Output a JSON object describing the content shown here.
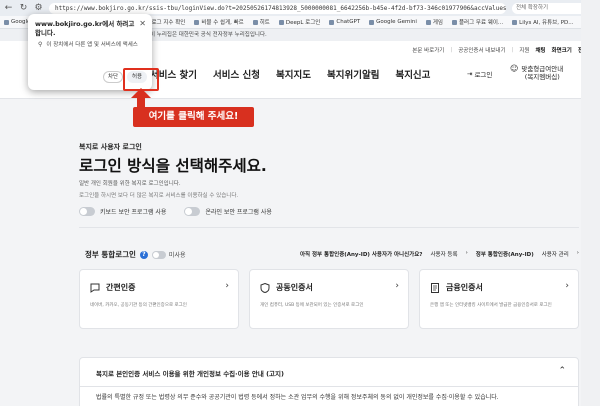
{
  "browser": {
    "url": "https://www.bokjiro.go.kr/ssis-tbu/loginView.do?t=20250526174813928_5000000081_6642256b-b45e-4f2d-bf73-346c01977906&accValues=c2#/",
    "extension_text": "전체 확장하기",
    "bookmarks": [
      "Google",
      "블로그 지수 확인",
      "비블 수 쉽게, 빠르",
      "히트",
      "DeepL 로그인",
      "ChatGPT",
      "Google Gemini",
      "게임",
      "플러그 무료 웨이...",
      "Lilys AI, 유튜브, PD..."
    ]
  },
  "gov_banner": "이 누리집은 대한민국 공식 전자정부 누리집입니다.",
  "header": {
    "util_links": [
      "본문 바로가기",
      "공공인증서 내보내기",
      "지원",
      "채팅",
      "화면크기",
      "전체"
    ],
    "nav": [
      "서비스 찾기",
      "서비스 신청",
      "복지지도",
      "복지위기알림",
      "복지신고"
    ],
    "login": "로그인",
    "help": [
      "맞춤형급여안내",
      "(복지멤버십)"
    ]
  },
  "popup": {
    "title": "www.bokjiro.go.kr에서 다음 작업을 하려고 합니다.",
    "title_display": "www.bokjiro.go.kr에서 하려고 합니다.",
    "message": "이 장치에서 다른 앱 및 서비스에 액세스",
    "block": "차단",
    "allow": "허용"
  },
  "callout": "여기를 클릭해 주세요!",
  "main": {
    "eyebrow": "복지로 사용자 로그인",
    "title": "로그인 방식을 선택해주세요.",
    "desc": "일반 개인 회원을 위한 복지로 로그인입니다.",
    "desc2": "로그인을 하시면 보다 더 많은 복지로 서비스를 이용하실 수 있습니다.",
    "toggle1": "키보드 보안 프로그램 사용",
    "toggle2": "온라인 보안 프로그램 사용",
    "gov_login": "정부 통합로그인",
    "unused": "미사용",
    "gov_right_q": "아직 정부 통합인증(Any-ID) 사용자가 아니신가요?",
    "signup": "사용자 등록",
    "gov_right_q2": "정부 통합인증(Any-ID)",
    "manage": "사용자 관리",
    "cards": [
      {
        "title": "간편인증",
        "desc": "네이버, 카카오, 공동기관 등의 간편인증으로 로그인"
      },
      {
        "title": "공동인증서",
        "desc": "개인 컴퓨터, USB 등에 보관되어 있는 인증서로 로그인"
      },
      {
        "title": "금융인증서",
        "desc": "은행 앱 또는 인터넷뱅킹 사이트에서 발급한 금융인증서로 로그인"
      }
    ],
    "notice_title": "복지로 본인인증 서비스 이용을 위한 개인정보 수집·이용 안내 (고지)",
    "notice_text": "법률의 특별한 규정 또는 법령상 의무 준수와 공공기관이 법령 등에서 정하는 소관 업무의 수행을 위해 정보주체의 동의 없이 개인정보를 수집·이용할 수 있습니다."
  },
  "colors": {
    "accent": "#d8301f",
    "brand": "#2a6fd6"
  }
}
